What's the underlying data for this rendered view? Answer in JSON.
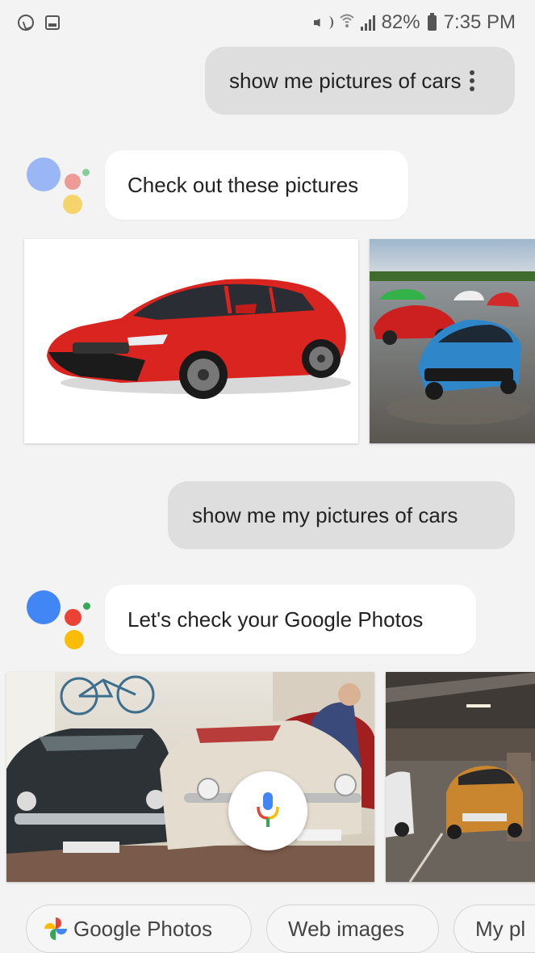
{
  "status_bar": {
    "battery_percent": "82%",
    "time": "7:35 PM",
    "left_icons": [
      "whatsapp-icon",
      "gallery-icon"
    ],
    "right_icons": [
      "mute-icon",
      "wifi-icon",
      "signal-icon",
      "battery-icon"
    ]
  },
  "conversation": [
    {
      "role": "user",
      "text": "show me pictures of cars"
    },
    {
      "role": "assistant",
      "text": "Check out these pictures"
    },
    {
      "role": "user",
      "text": "show me my pictures of cars"
    },
    {
      "role": "assistant",
      "text": "Let's check your Google Photos"
    }
  ],
  "suggestion_chips": [
    {
      "label": "Google Photos",
      "icon": "google-photos-icon"
    },
    {
      "label": "Web images"
    },
    {
      "label": "My pl"
    }
  ],
  "colors": {
    "background": "#f3f3f3",
    "user_bubble": "#dedede",
    "assistant_bubble": "#ffffff",
    "google_blue": "#4285F4",
    "google_red": "#EA4335",
    "google_yellow": "#FBBC05",
    "google_green": "#34A853"
  }
}
